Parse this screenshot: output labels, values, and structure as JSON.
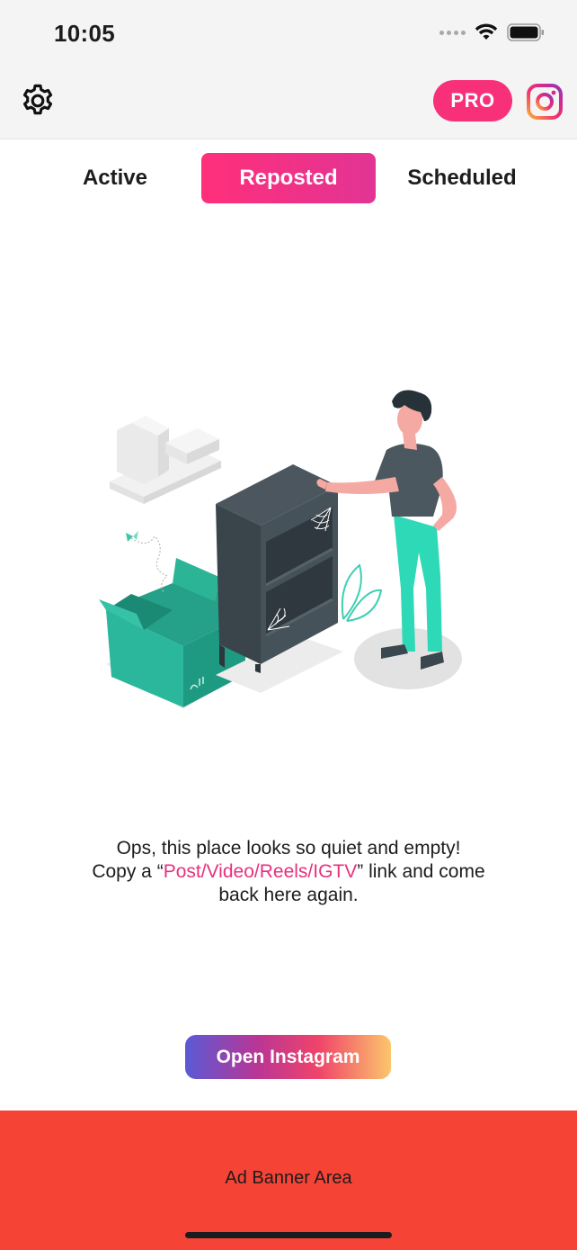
{
  "status_bar": {
    "time": "10:05"
  },
  "header": {
    "settings_icon": "gear-icon",
    "pro_label": "PRO",
    "instagram_icon": "instagram-icon"
  },
  "tabs": [
    {
      "label": "Active",
      "selected": false
    },
    {
      "label": "Reposted",
      "selected": true
    },
    {
      "label": "Scheduled",
      "selected": false
    }
  ],
  "empty_state": {
    "line1": "Ops, this place looks so quiet and empty!",
    "line2_prefix": "Copy a “",
    "line2_link": "Post/Video/Reels/IGTV",
    "line2_suffix": "” link and come",
    "line3": "back here again."
  },
  "actions": {
    "open_instagram_label": "Open Instagram"
  },
  "ad": {
    "label": "Ad Banner Area"
  },
  "colors": {
    "accent_pink": "#f8307a",
    "ad_red": "#f54436",
    "link_pink": "#e8307e"
  }
}
